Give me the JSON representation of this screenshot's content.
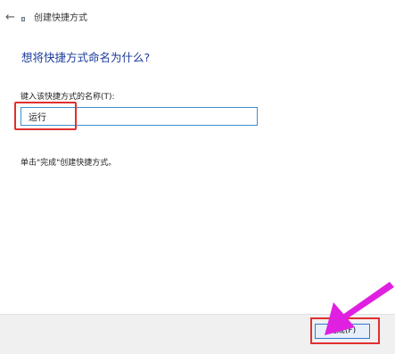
{
  "window": {
    "title": "创建快捷方式",
    "back_icon": "back-arrow-icon",
    "app_icon": "shortcut-icon"
  },
  "main": {
    "heading": "想将快捷方式命名为什么?",
    "name_label": "键入该快捷方式的名称(T):",
    "name_value": "运行",
    "hint": "单击\"完成\"创建快捷方式。"
  },
  "footer": {
    "finish_label": "完成(F)"
  },
  "annotations": {
    "highlight_color": "#e03030",
    "arrow_color": "#e020e0"
  }
}
